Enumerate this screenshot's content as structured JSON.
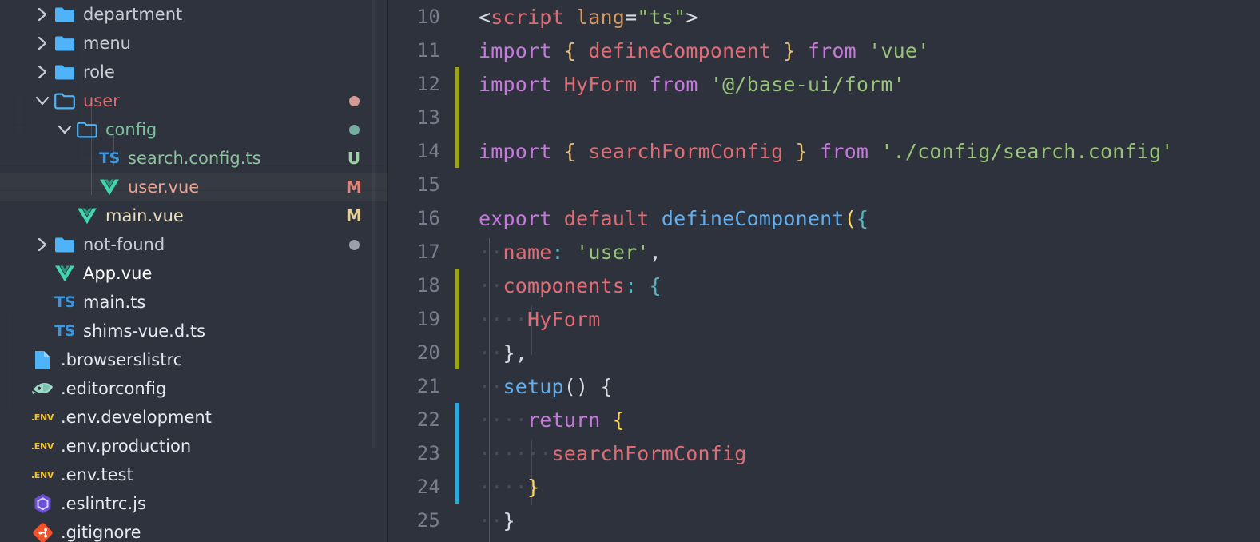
{
  "app": {
    "theme_bg": "#2e323c",
    "sidebar_bg": "#2f333d"
  },
  "sidebar": {
    "name": "explorer-file-tree",
    "items": [
      {
        "label": "department",
        "depth": 2,
        "type": "folder",
        "state": "collapsed",
        "icon": "folder-closed-icon",
        "color": "#c8ccd4",
        "marker": "",
        "marker_color": ""
      },
      {
        "label": "menu",
        "depth": 2,
        "type": "folder",
        "state": "collapsed",
        "icon": "folder-closed-icon",
        "color": "#c8ccd4",
        "marker": "",
        "marker_color": ""
      },
      {
        "label": "role",
        "depth": 2,
        "type": "folder",
        "state": "collapsed",
        "icon": "folder-closed-icon",
        "color": "#c8ccd4",
        "marker": "",
        "marker_color": ""
      },
      {
        "label": "user",
        "depth": 2,
        "type": "folder",
        "state": "expanded",
        "icon": "folder-open-icon",
        "color": "#e06c75",
        "marker": "dot",
        "marker_color": "#d49a94"
      },
      {
        "label": "config",
        "depth": 3,
        "type": "folder",
        "state": "expanded",
        "icon": "folder-open-icon",
        "color": "#7bbf9e",
        "marker": "dot",
        "marker_color": "#73ada0"
      },
      {
        "label": "search.config.ts",
        "depth": 4,
        "type": "file",
        "state": "",
        "icon": "typescript-icon",
        "color": "#8fbf9f",
        "marker": "U",
        "marker_color": "#9fd0a8"
      },
      {
        "label": "user.vue",
        "depth": 4,
        "type": "file",
        "state": "",
        "icon": "vue-icon",
        "color": "#e8a08f",
        "marker": "M",
        "marker_color": "#e0857a",
        "selected": true
      },
      {
        "label": "main.vue",
        "depth": 3,
        "type": "file",
        "state": "",
        "icon": "vue-icon",
        "color": "#e8e0c0",
        "marker": "M",
        "marker_color": "#e5d09a"
      },
      {
        "label": "not-found",
        "depth": 2,
        "type": "folder",
        "state": "collapsed",
        "icon": "folder-closed-icon",
        "color": "#c8ccd4",
        "marker": "dot",
        "marker_color": "#9ba0aa"
      },
      {
        "label": "App.vue",
        "depth": 2,
        "type": "file",
        "state": "",
        "icon": "vue-icon",
        "color": "#ffffff",
        "marker": "",
        "marker_color": ""
      },
      {
        "label": "main.ts",
        "depth": 2,
        "type": "file",
        "state": "",
        "icon": "typescript-icon",
        "color": "#e6e9ef",
        "marker": "",
        "marker_color": ""
      },
      {
        "label": "shims-vue.d.ts",
        "depth": 2,
        "type": "file",
        "state": "",
        "icon": "typescript-icon",
        "color": "#e6e9ef",
        "marker": "",
        "marker_color": ""
      },
      {
        "label": ".browserslistrc",
        "depth": 1,
        "type": "file",
        "state": "",
        "icon": "document-icon",
        "color": "#e6e9ef",
        "marker": "",
        "marker_color": ""
      },
      {
        "label": ".editorconfig",
        "depth": 1,
        "type": "file",
        "state": "",
        "icon": "editorconfig-icon",
        "color": "#e6e9ef",
        "marker": "",
        "marker_color": ""
      },
      {
        "label": ".env.development",
        "depth": 1,
        "type": "file",
        "state": "",
        "icon": "env-icon",
        "color": "#e6e9ef",
        "marker": "",
        "marker_color": ""
      },
      {
        "label": ".env.production",
        "depth": 1,
        "type": "file",
        "state": "",
        "icon": "env-icon",
        "color": "#e6e9ef",
        "marker": "",
        "marker_color": ""
      },
      {
        "label": ".env.test",
        "depth": 1,
        "type": "file",
        "state": "",
        "icon": "env-icon",
        "color": "#e6e9ef",
        "marker": "",
        "marker_color": ""
      },
      {
        "label": ".eslintrc.js",
        "depth": 1,
        "type": "file",
        "state": "",
        "icon": "eslint-icon",
        "color": "#e6e9ef",
        "marker": "",
        "marker_color": ""
      },
      {
        "label": ".gitignore",
        "depth": 1,
        "type": "file",
        "state": "",
        "icon": "git-icon",
        "color": "#e6e9ef",
        "marker": "",
        "marker_color": ""
      }
    ]
  },
  "editor": {
    "name": "code-editor",
    "language": "vue",
    "first_visible_line": 10,
    "last_visible_line": 25,
    "gutter_colors": {
      "modified": "#9ba414",
      "added": "#2fa8dd"
    },
    "lines": [
      {
        "num": "10",
        "change": "none",
        "tokens": [
          {
            "t": "<",
            "c": "t-plain"
          },
          {
            "t": "script",
            "c": "t-tag"
          },
          {
            "t": " ",
            "c": "t-ws"
          },
          {
            "t": "lang",
            "c": "t-attr"
          },
          {
            "t": "=",
            "c": "t-plain"
          },
          {
            "t": "\"ts\"",
            "c": "t-str"
          },
          {
            "t": ">",
            "c": "t-plain"
          }
        ]
      },
      {
        "num": "11",
        "change": "none",
        "tokens": [
          {
            "t": "import",
            "c": "t-kw"
          },
          {
            "t": " ",
            "c": "t-ws"
          },
          {
            "t": "{",
            "c": "t-brace-y"
          },
          {
            "t": " ",
            "c": "t-ws"
          },
          {
            "t": "defineComponent",
            "c": "t-prop"
          },
          {
            "t": " ",
            "c": "t-ws"
          },
          {
            "t": "}",
            "c": "t-brace-y"
          },
          {
            "t": " ",
            "c": "t-ws"
          },
          {
            "t": "from",
            "c": "t-kw"
          },
          {
            "t": " ",
            "c": "t-ws"
          },
          {
            "t": "'vue'",
            "c": "t-str"
          }
        ]
      },
      {
        "num": "12",
        "change": "modified",
        "tokens": [
          {
            "t": "import",
            "c": "t-kw"
          },
          {
            "t": " ",
            "c": "t-ws"
          },
          {
            "t": "HyForm",
            "c": "t-prop"
          },
          {
            "t": " ",
            "c": "t-ws"
          },
          {
            "t": "from",
            "c": "t-kw"
          },
          {
            "t": " ",
            "c": "t-ws"
          },
          {
            "t": "'@/base-ui/form'",
            "c": "t-str"
          }
        ]
      },
      {
        "num": "13",
        "change": "modified",
        "tokens": []
      },
      {
        "num": "14",
        "change": "modified",
        "tokens": [
          {
            "t": "import",
            "c": "t-kw"
          },
          {
            "t": " ",
            "c": "t-ws"
          },
          {
            "t": "{",
            "c": "t-brace-y"
          },
          {
            "t": " ",
            "c": "t-ws"
          },
          {
            "t": "searchFormConfig",
            "c": "t-prop"
          },
          {
            "t": " ",
            "c": "t-ws"
          },
          {
            "t": "}",
            "c": "t-brace-y"
          },
          {
            "t": " ",
            "c": "t-ws"
          },
          {
            "t": "from",
            "c": "t-kw"
          },
          {
            "t": " ",
            "c": "t-ws"
          },
          {
            "t": "'./config/search.config'",
            "c": "t-str"
          }
        ]
      },
      {
        "num": "15",
        "change": "none",
        "tokens": []
      },
      {
        "num": "16",
        "change": "none",
        "tokens": [
          {
            "t": "export",
            "c": "t-kw"
          },
          {
            "t": " ",
            "c": "t-ws"
          },
          {
            "t": "default",
            "c": "t-tag"
          },
          {
            "t": " ",
            "c": "t-ws"
          },
          {
            "t": "defineComponent",
            "c": "t-fn"
          },
          {
            "t": "(",
            "c": "t-yellow"
          },
          {
            "t": "{",
            "c": "t-cyan"
          }
        ]
      },
      {
        "num": "17",
        "change": "none",
        "tokens": [
          {
            "t": "··",
            "c": "t-ws"
          },
          {
            "t": "name",
            "c": "t-prop"
          },
          {
            "t": ":",
            "c": "t-colon"
          },
          {
            "t": " ",
            "c": "t-ws"
          },
          {
            "t": "'user'",
            "c": "t-str"
          },
          {
            "t": ",",
            "c": "t-plain"
          }
        ]
      },
      {
        "num": "18",
        "change": "modified",
        "tokens": [
          {
            "t": "··",
            "c": "t-ws"
          },
          {
            "t": "components",
            "c": "t-prop"
          },
          {
            "t": ":",
            "c": "t-colon"
          },
          {
            "t": " ",
            "c": "t-ws"
          },
          {
            "t": "{",
            "c": "t-cyan"
          }
        ]
      },
      {
        "num": "19",
        "change": "modified",
        "tokens": [
          {
            "t": "····",
            "c": "t-ws"
          },
          {
            "t": "HyForm",
            "c": "t-prop"
          }
        ]
      },
      {
        "num": "20",
        "change": "modified",
        "tokens": [
          {
            "t": "··",
            "c": "t-ws"
          },
          {
            "t": "}",
            "c": "t-plain"
          },
          {
            "t": ",",
            "c": "t-plain"
          }
        ]
      },
      {
        "num": "21",
        "change": "none",
        "tokens": [
          {
            "t": "··",
            "c": "t-ws"
          },
          {
            "t": "setup",
            "c": "t-fn"
          },
          {
            "t": "()",
            "c": "t-plain"
          },
          {
            "t": " ",
            "c": "t-ws"
          },
          {
            "t": "{",
            "c": "t-plain"
          }
        ]
      },
      {
        "num": "22",
        "change": "added",
        "tokens": [
          {
            "t": "····",
            "c": "t-ws"
          },
          {
            "t": "return",
            "c": "t-kw"
          },
          {
            "t": " ",
            "c": "t-ws"
          },
          {
            "t": "{",
            "c": "t-yellow"
          }
        ]
      },
      {
        "num": "23",
        "change": "added",
        "tokens": [
          {
            "t": "······",
            "c": "t-ws"
          },
          {
            "t": "searchFormConfig",
            "c": "t-prop"
          }
        ]
      },
      {
        "num": "24",
        "change": "added",
        "tokens": [
          {
            "t": "····",
            "c": "t-ws"
          },
          {
            "t": "}",
            "c": "t-yellow"
          }
        ]
      },
      {
        "num": "25",
        "change": "none",
        "tokens": [
          {
            "t": "··",
            "c": "t-ws"
          },
          {
            "t": "}",
            "c": "t-plain"
          }
        ]
      }
    ]
  }
}
